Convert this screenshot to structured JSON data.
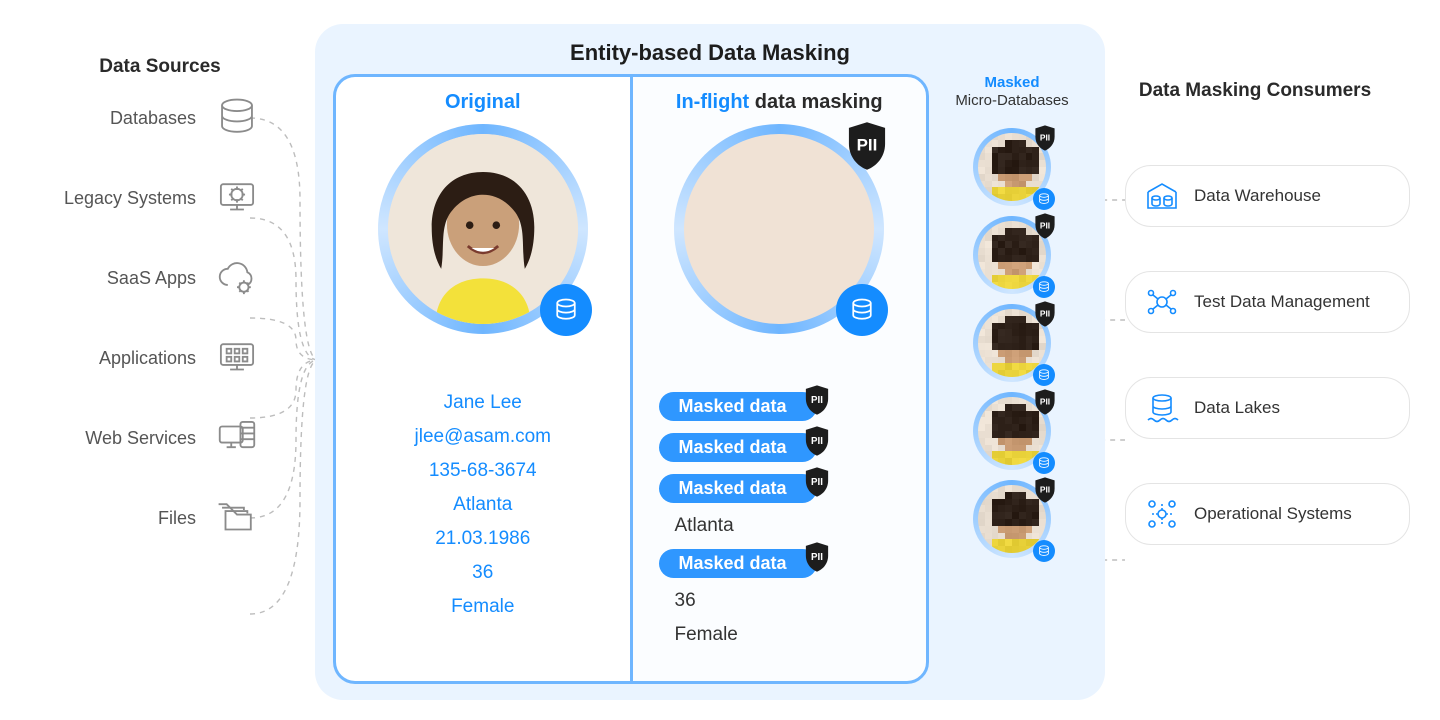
{
  "titles": {
    "sources": "Data Sources",
    "center": "Entity-based Data Masking",
    "consumers": "Data Masking Consumers",
    "micro_masked": "Masked",
    "micro_db": "Micro-Databases"
  },
  "sources": [
    {
      "label": "Databases",
      "icon": "database"
    },
    {
      "label": "Legacy Systems",
      "icon": "legacy"
    },
    {
      "label": "SaaS Apps",
      "icon": "cloud"
    },
    {
      "label": "Applications",
      "icon": "apps"
    },
    {
      "label": "Web Services",
      "icon": "webservices"
    },
    {
      "label": "Files",
      "icon": "files"
    }
  ],
  "consumers": [
    {
      "label": "Data Warehouse",
      "icon": "warehouse"
    },
    {
      "label": "Test Data Management",
      "icon": "testdata"
    },
    {
      "label": "Data Lakes",
      "icon": "lake"
    },
    {
      "label": "Operational Systems",
      "icon": "ops"
    }
  ],
  "cards": {
    "original": {
      "title": "Original",
      "person": {
        "name": "Jane Lee",
        "email": "jlee@asam.com",
        "ssn": "135-68-3674",
        "city": "Atlanta",
        "dob": "21.03.1986",
        "age": "36",
        "gender": "Female"
      }
    },
    "masked": {
      "title_highlight": "In-flight",
      "title_rest": " data masking",
      "pill_label": "Masked data",
      "pii_label": "PII",
      "rows": [
        {
          "type": "masked"
        },
        {
          "type": "masked"
        },
        {
          "type": "masked"
        },
        {
          "type": "plain",
          "value": "Atlanta"
        },
        {
          "type": "masked"
        },
        {
          "type": "plain",
          "value": "36"
        },
        {
          "type": "plain",
          "value": "Female"
        }
      ]
    }
  },
  "micro_count": 5
}
